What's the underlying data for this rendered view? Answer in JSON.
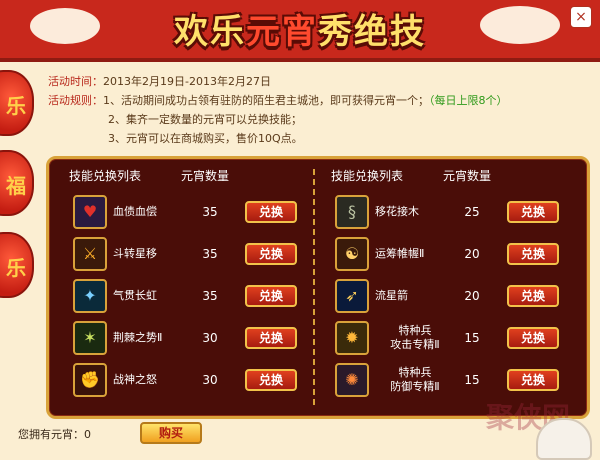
{
  "header": {
    "title_part1": "欢乐",
    "title_part2": "元宵",
    "title_part3": "秀绝技",
    "close_label": "×"
  },
  "info": {
    "time_label": "活动时间：",
    "time_value": "2013年2月19日-2013年2月27日",
    "rules_label": "活动规则：",
    "rule1": "1、活动期间成功占领有驻防的陌生君主城池，即可获得元宵一个；",
    "rule1_limit": "（每日上限8个）",
    "rule2": "2、集齐一定数量的元宵可以兑换技能；",
    "rule3": "3、元宵可以在商城购买，售价10Q点。"
  },
  "table": {
    "col_title": "技能兑换列表",
    "qty_title": "元宵数量",
    "exchange_label": "兑换",
    "left": [
      {
        "name": "血债血偿",
        "qty": "35",
        "icon": "heart-skill-icon"
      },
      {
        "name": "斗转星移",
        "qty": "35",
        "icon": "sword-strike-icon"
      },
      {
        "name": "气贯长虹",
        "qty": "35",
        "icon": "rainbow-slash-icon"
      },
      {
        "name": "荆棘之势Ⅱ",
        "qty": "30",
        "icon": "thorn-skill-icon"
      },
      {
        "name": "战神之怒",
        "qty": "30",
        "icon": "war-god-icon"
      }
    ],
    "right": [
      {
        "name": "移花接木",
        "qty": "25",
        "icon": "serpent-skill-icon"
      },
      {
        "name": "运筹帷幄Ⅱ",
        "qty": "20",
        "icon": "strategy-figure-icon"
      },
      {
        "name": "流星箭",
        "qty": "20",
        "icon": "meteor-arrow-icon"
      },
      {
        "name": "特种兵攻击专精Ⅱ",
        "name_line1": "特种兵",
        "name_line2": "攻击专精Ⅱ",
        "qty": "15",
        "icon": "special-attack-icon"
      },
      {
        "name": "特种兵防御专精Ⅱ",
        "name_line1": "特种兵",
        "name_line2": "防御专精Ⅱ",
        "qty": "15",
        "icon": "special-defense-icon"
      }
    ]
  },
  "footer": {
    "owned_label": "您拥有元宵：",
    "owned_value": "0",
    "buy_label": "购买"
  },
  "watermark": "聚侠网",
  "lantern_chars": [
    "乐",
    "福",
    "乐"
  ],
  "colors": {
    "header_red": "#c8281c",
    "panel_bg": "#4a0d08",
    "gold_border": "#d9a23a",
    "button_red": "#c02a16",
    "limit_green": "#2f9a1a"
  }
}
